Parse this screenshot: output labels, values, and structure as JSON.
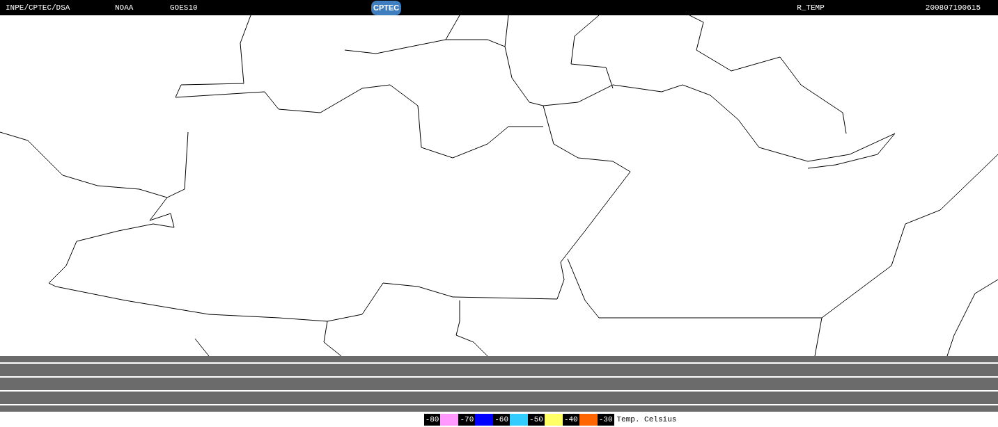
{
  "header": {
    "labels": [
      "INPE/CPTEC/DSA",
      "NOAA",
      "GOES10"
    ],
    "logo": "CPTEC",
    "product": "R_TEMP",
    "timestamp": "200807190615"
  },
  "legend": {
    "entries": [
      {
        "label": "-80",
        "color": "#ff99ff"
      },
      {
        "label": "-70",
        "color": "#0000ff"
      },
      {
        "label": "-60",
        "color": "#33ccff"
      },
      {
        "label": "-50",
        "color": "#ffff66"
      },
      {
        "label": "-40",
        "color": "#ff6600"
      },
      {
        "label": "-30"
      }
    ],
    "unit": "Temp. Celsius"
  }
}
